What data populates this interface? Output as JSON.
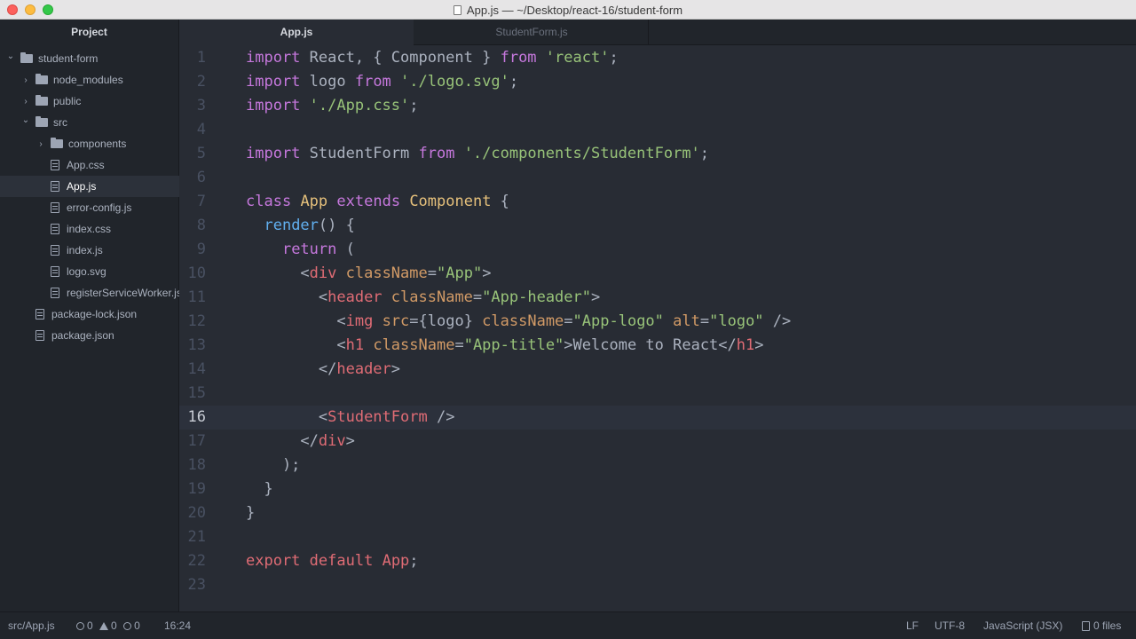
{
  "window": {
    "title": "App.js — ~/Desktop/react-16/student-form"
  },
  "sidebar": {
    "header": "Project",
    "items": [
      {
        "label": "student-form",
        "kind": "folder",
        "expanded": true,
        "depth": 0
      },
      {
        "label": "node_modules",
        "kind": "folder",
        "expanded": false,
        "depth": 1
      },
      {
        "label": "public",
        "kind": "folder",
        "expanded": false,
        "depth": 1
      },
      {
        "label": "src",
        "kind": "folder",
        "expanded": true,
        "depth": 1
      },
      {
        "label": "components",
        "kind": "folder",
        "expanded": false,
        "depth": 2
      },
      {
        "label": "App.css",
        "kind": "file",
        "depth": 2
      },
      {
        "label": "App.js",
        "kind": "file",
        "depth": 2,
        "selected": true
      },
      {
        "label": "error-config.js",
        "kind": "file",
        "depth": 2
      },
      {
        "label": "index.css",
        "kind": "file",
        "depth": 2
      },
      {
        "label": "index.js",
        "kind": "file",
        "depth": 2
      },
      {
        "label": "logo.svg",
        "kind": "file",
        "depth": 2
      },
      {
        "label": "registerServiceWorker.js",
        "kind": "file",
        "depth": 2
      },
      {
        "label": "package-lock.json",
        "kind": "file",
        "depth": 1
      },
      {
        "label": "package.json",
        "kind": "file",
        "depth": 1
      }
    ]
  },
  "tabs": [
    {
      "label": "App.js",
      "active": true
    },
    {
      "label": "StudentForm.js",
      "active": false
    }
  ],
  "editor": {
    "cursor_line": 16,
    "lines": [
      {
        "n": "1",
        "tokens": [
          [
            "kw",
            "import"
          ],
          [
            "pl",
            " React, { Component } "
          ],
          [
            "kw",
            "from"
          ],
          [
            "pl",
            " "
          ],
          [
            "str",
            "'react'"
          ],
          [
            "pl",
            ";"
          ]
        ]
      },
      {
        "n": "2",
        "tokens": [
          [
            "kw",
            "import"
          ],
          [
            "pl",
            " logo "
          ],
          [
            "kw",
            "from"
          ],
          [
            "pl",
            " "
          ],
          [
            "str",
            "'./logo.svg'"
          ],
          [
            "pl",
            ";"
          ]
        ]
      },
      {
        "n": "3",
        "tokens": [
          [
            "kw",
            "import"
          ],
          [
            "pl",
            " "
          ],
          [
            "str",
            "'./App.css'"
          ],
          [
            "pl",
            ";"
          ]
        ]
      },
      {
        "n": "4",
        "tokens": []
      },
      {
        "n": "5",
        "tokens": [
          [
            "kw",
            "import"
          ],
          [
            "pl",
            " StudentForm "
          ],
          [
            "kw",
            "from"
          ],
          [
            "pl",
            " "
          ],
          [
            "str",
            "'./components/StudentForm'"
          ],
          [
            "pl",
            ";"
          ]
        ]
      },
      {
        "n": "6",
        "tokens": []
      },
      {
        "n": "7",
        "tokens": [
          [
            "kw",
            "class"
          ],
          [
            "pl",
            " "
          ],
          [
            "cls",
            "App"
          ],
          [
            "pl",
            " "
          ],
          [
            "kw",
            "extends"
          ],
          [
            "pl",
            " "
          ],
          [
            "cls",
            "Component"
          ],
          [
            "pl",
            " {"
          ]
        ]
      },
      {
        "n": "8",
        "tokens": [
          [
            "pl",
            "  "
          ],
          [
            "fn",
            "render"
          ],
          [
            "pl",
            "() {"
          ]
        ]
      },
      {
        "n": "9",
        "tokens": [
          [
            "pl",
            "    "
          ],
          [
            "kw",
            "return"
          ],
          [
            "pl",
            " ("
          ]
        ]
      },
      {
        "n": "10",
        "tokens": [
          [
            "pl",
            "      <"
          ],
          [
            "tag",
            "div"
          ],
          [
            "pl",
            " "
          ],
          [
            "attr",
            "className"
          ],
          [
            "pl",
            "="
          ],
          [
            "str",
            "\"App\""
          ],
          [
            "pl",
            ">"
          ]
        ]
      },
      {
        "n": "11",
        "tokens": [
          [
            "pl",
            "        <"
          ],
          [
            "tag",
            "header"
          ],
          [
            "pl",
            " "
          ],
          [
            "attr",
            "className"
          ],
          [
            "pl",
            "="
          ],
          [
            "str",
            "\"App-header\""
          ],
          [
            "pl",
            ">"
          ]
        ]
      },
      {
        "n": "12",
        "tokens": [
          [
            "pl",
            "          <"
          ],
          [
            "tag",
            "img"
          ],
          [
            "pl",
            " "
          ],
          [
            "attr",
            "src"
          ],
          [
            "pl",
            "={logo} "
          ],
          [
            "attr",
            "className"
          ],
          [
            "pl",
            "="
          ],
          [
            "str",
            "\"App-logo\""
          ],
          [
            "pl",
            " "
          ],
          [
            "attr",
            "alt"
          ],
          [
            "pl",
            "="
          ],
          [
            "str",
            "\"logo\""
          ],
          [
            "pl",
            " />"
          ]
        ]
      },
      {
        "n": "13",
        "tokens": [
          [
            "pl",
            "          <"
          ],
          [
            "tag",
            "h1"
          ],
          [
            "pl",
            " "
          ],
          [
            "attr",
            "className"
          ],
          [
            "pl",
            "="
          ],
          [
            "str",
            "\"App-title\""
          ],
          [
            "pl",
            ">Welcome to React</"
          ],
          [
            "tag",
            "h1"
          ],
          [
            "pl",
            ">"
          ]
        ]
      },
      {
        "n": "14",
        "tokens": [
          [
            "pl",
            "        </"
          ],
          [
            "tag",
            "header"
          ],
          [
            "pl",
            ">"
          ]
        ]
      },
      {
        "n": "15",
        "tokens": []
      },
      {
        "n": "16",
        "tokens": [
          [
            "pl",
            "        <"
          ],
          [
            "tag",
            "StudentForm"
          ],
          [
            "pl",
            " />"
          ]
        ]
      },
      {
        "n": "17",
        "tokens": [
          [
            "pl",
            "      </"
          ],
          [
            "tag",
            "div"
          ],
          [
            "pl",
            ">"
          ]
        ]
      },
      {
        "n": "18",
        "tokens": [
          [
            "pl",
            "    );"
          ]
        ]
      },
      {
        "n": "19",
        "tokens": [
          [
            "pl",
            "  }"
          ]
        ]
      },
      {
        "n": "20",
        "tokens": [
          [
            "pl",
            "}"
          ]
        ]
      },
      {
        "n": "21",
        "tokens": []
      },
      {
        "n": "22",
        "tokens": [
          [
            "exp",
            "export"
          ],
          [
            "pl",
            " "
          ],
          [
            "exp",
            "default"
          ],
          [
            "pl",
            " "
          ],
          [
            "exp",
            "App"
          ],
          [
            "pl",
            ";"
          ]
        ]
      },
      {
        "n": "23",
        "tokens": []
      }
    ]
  },
  "statusbar": {
    "path": "src/App.js",
    "errors": "0",
    "warnings": "0",
    "infos": "0",
    "position": "16:24",
    "line_ending": "LF",
    "encoding": "UTF-8",
    "grammar": "JavaScript (JSX)",
    "files": "0 files"
  },
  "icons": {
    "folder": "folder-icon",
    "file": "file-icon",
    "chevron_right": "chevron-right-icon",
    "chevron_down": "chevron-down-icon",
    "collapse": "chevron-left-icon"
  },
  "colors": {
    "editor_bg": "#282c34",
    "sidebar_bg": "#21252b",
    "keyword": "#c678dd",
    "string": "#98c379",
    "tag": "#e06c75",
    "attribute": "#d19a66",
    "class": "#e5c07b",
    "function": "#61afef"
  }
}
